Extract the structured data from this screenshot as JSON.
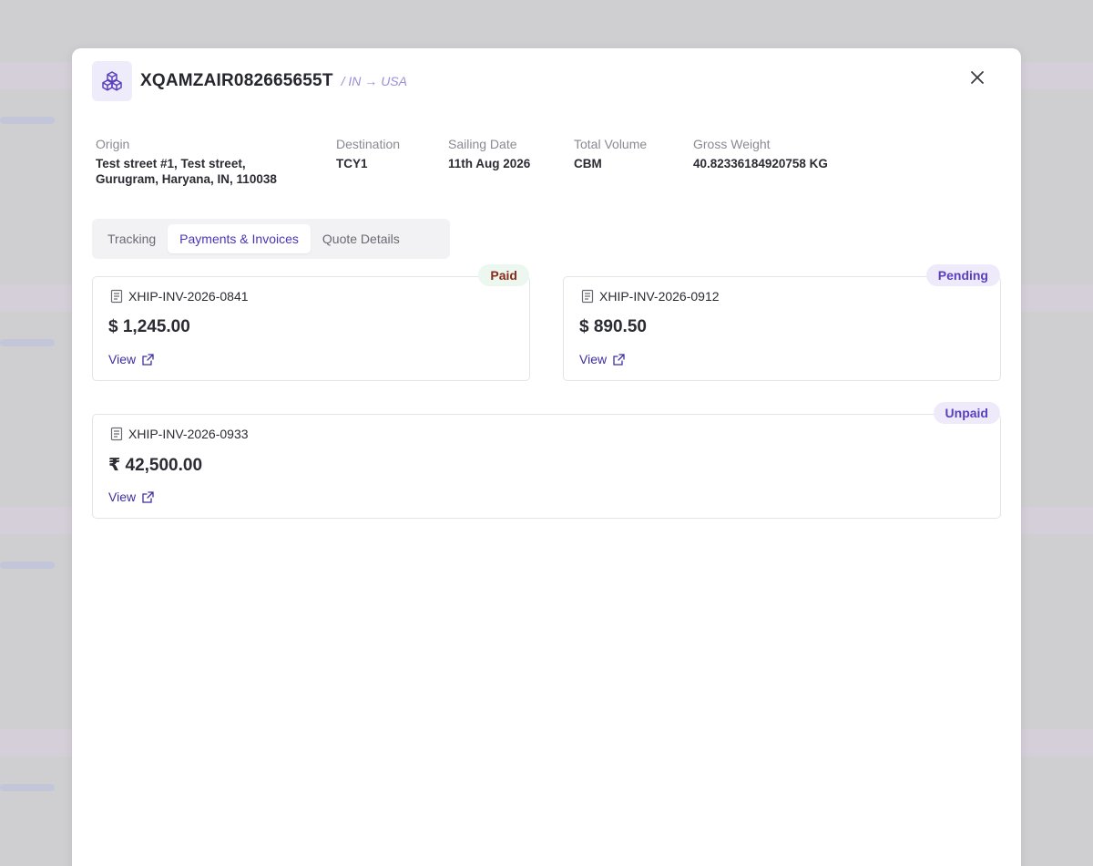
{
  "header": {
    "shipment_id": "XQAMZAIR082665655T",
    "route": "/ IN → USA"
  },
  "details": {
    "origin": {
      "label": "Origin",
      "value_line1": "Test street #1, Test street,",
      "value_line2": "Gurugram, Haryana, IN, 110038"
    },
    "destination": {
      "label": "Destination",
      "value": "TCY1"
    },
    "sailing_date": {
      "label": "Sailing Date",
      "value": "11th Aug 2026"
    },
    "total_volume": {
      "label": "Total Volume",
      "value": "CBM"
    },
    "gross_weight": {
      "label": "Gross Weight",
      "value": "40.82336184920758 KG"
    }
  },
  "tabs": [
    {
      "label": "Tracking",
      "active": false
    },
    {
      "label": "Payments & Invoices",
      "active": true
    },
    {
      "label": "Quote Details",
      "active": false
    }
  ],
  "invoices": [
    {
      "number": "XHIP-INV-2026-0841",
      "amount": "$ 1,245.00",
      "status": "Paid",
      "view_label": "View"
    },
    {
      "number": "XHIP-INV-2026-0912",
      "amount": "$ 890.50",
      "status": "Pending",
      "view_label": "View"
    },
    {
      "number": "XHIP-INV-2026-0933",
      "amount": "₹ 42,500.00",
      "status": "Unpaid",
      "view_label": "View"
    }
  ],
  "colors": {
    "accent": "#4a35b8",
    "paid_text": "#8a2a1c",
    "pending_text": "#5a3fc0"
  },
  "icons": {
    "logo": "cubes-icon",
    "close": "close-icon",
    "document": "document-icon",
    "external_link": "external-link-icon"
  }
}
